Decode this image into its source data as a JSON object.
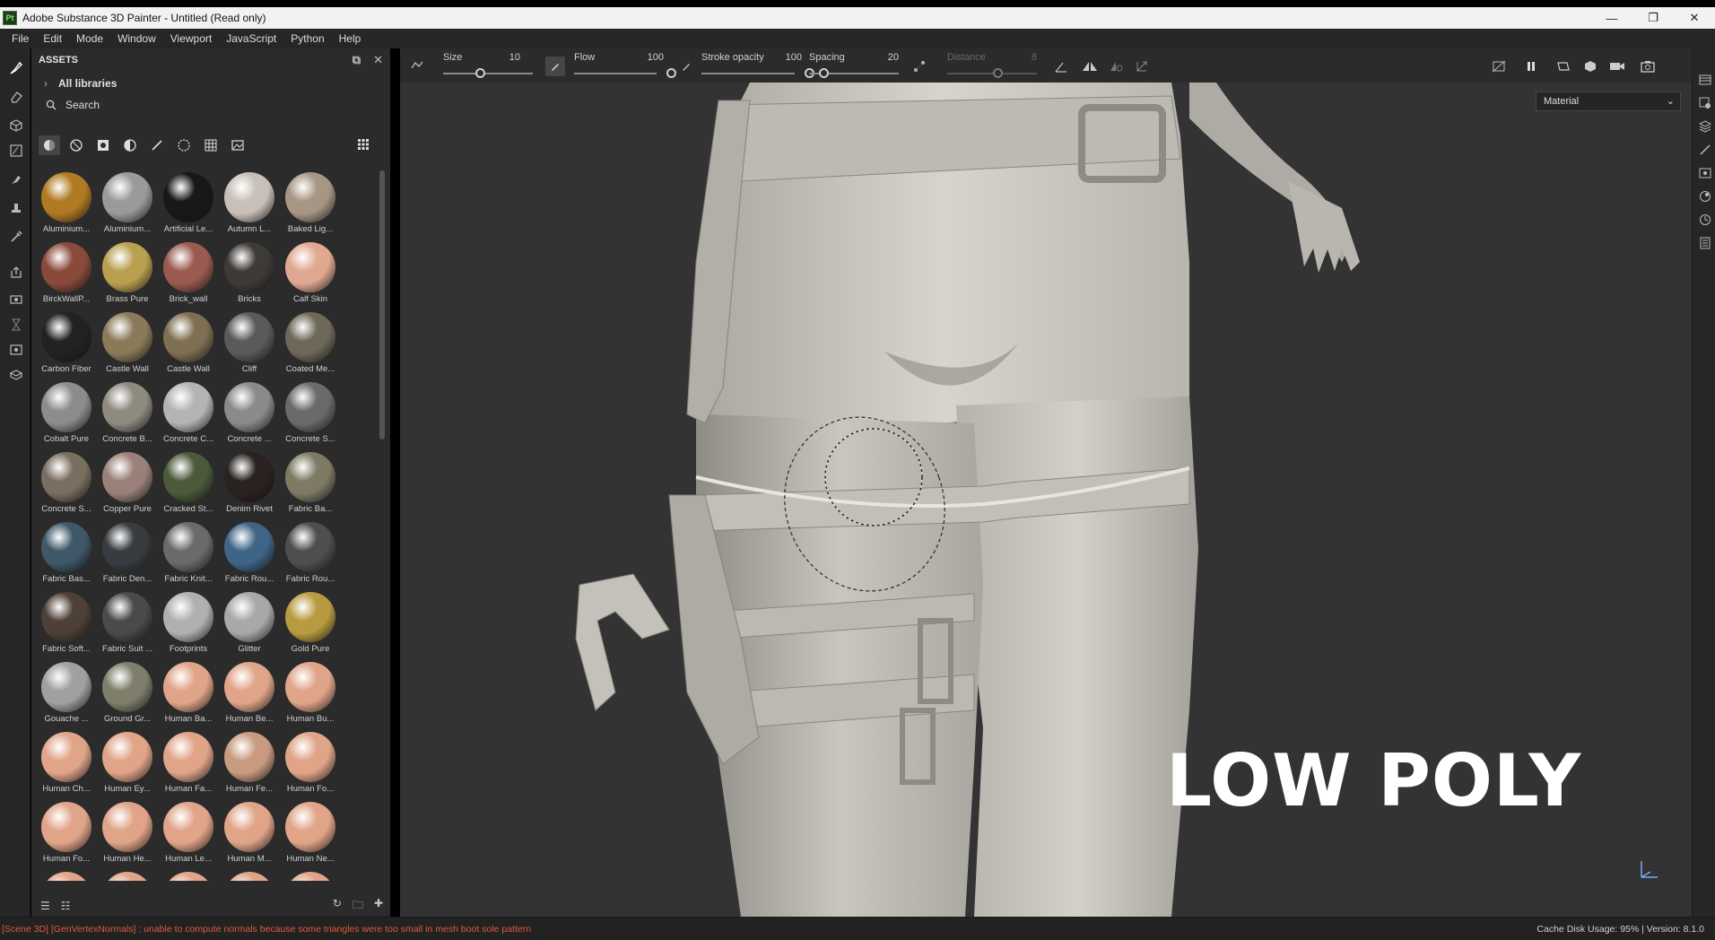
{
  "window": {
    "title": "Adobe Substance 3D Painter - Untitled (Read only)",
    "app_icon": "Pt",
    "controls": [
      "minimize-icon",
      "restore-icon",
      "close-icon"
    ]
  },
  "menu": [
    "File",
    "Edit",
    "Mode",
    "Window",
    "Viewport",
    "JavaScript",
    "Python",
    "Help"
  ],
  "assets_panel": {
    "title": "ASSETS",
    "libraries_label": "All libraries",
    "search_placeholder": "Search",
    "materials": [
      {
        "label": "Aluminium...",
        "color": "#b07a22"
      },
      {
        "label": "Aluminium...",
        "color": "#9a9a9a"
      },
      {
        "label": "Artificial Le...",
        "color": "#181818"
      },
      {
        "label": "Autumn L...",
        "color": "#c8c0b8"
      },
      {
        "label": "Baked Lig...",
        "color": "#a89684"
      },
      {
        "label": "BirckWallP...",
        "color": "#8a4a3a"
      },
      {
        "label": "Brass Pure",
        "color": "#b8a050"
      },
      {
        "label": "Brick_wall",
        "color": "#9a5a50"
      },
      {
        "label": "Bricks",
        "color": "#3e3a36"
      },
      {
        "label": "Calf Skin",
        "color": "#e0a890"
      },
      {
        "label": "Carbon Fiber",
        "color": "#222222"
      },
      {
        "label": "Castle Wall",
        "color": "#8a7a5a"
      },
      {
        "label": "Castle Wall",
        "color": "#7e6e52"
      },
      {
        "label": "Cliff",
        "color": "#5a5a58"
      },
      {
        "label": "Coated Me...",
        "color": "#6e6858"
      },
      {
        "label": "Cobalt Pure",
        "color": "#8c8c8c"
      },
      {
        "label": "Concrete B...",
        "color": "#8e8a80"
      },
      {
        "label": "Concrete C...",
        "color": "#b4b4b4"
      },
      {
        "label": "Concrete ...",
        "color": "#8a8a8a"
      },
      {
        "label": "Concrete S...",
        "color": "#6a6a6a"
      },
      {
        "label": "Concrete S...",
        "color": "#7a6e60"
      },
      {
        "label": "Copper Pure",
        "color": "#9a8078"
      },
      {
        "label": "Cracked St...",
        "color": "#4a5a3a"
      },
      {
        "label": "Denim Rivet",
        "color": "#2a2220"
      },
      {
        "label": "Fabric Ba...",
        "color": "#7e7a64"
      },
      {
        "label": "Fabric Bas...",
        "color": "#3e5868"
      },
      {
        "label": "Fabric Den...",
        "color": "#383c40"
      },
      {
        "label": "Fabric Knit...",
        "color": "#6a6a6a"
      },
      {
        "label": "Fabric Rou...",
        "color": "#3e6486"
      },
      {
        "label": "Fabric Rou...",
        "color": "#4e4e4e"
      },
      {
        "label": "Fabric Soft...",
        "color": "#4e4036"
      },
      {
        "label": "Fabric Suit ...",
        "color": "#4a4a4a"
      },
      {
        "label": "Footprints",
        "color": "#b0b0b0"
      },
      {
        "label": "Glitter",
        "color": "#a8a8a8"
      },
      {
        "label": "Gold Pure",
        "color": "#b89a40"
      },
      {
        "label": "Gouache ...",
        "color": "#a0a0a0"
      },
      {
        "label": "Ground Gr...",
        "color": "#7e7e6a"
      },
      {
        "label": "Human Ba...",
        "color": "#e0a488"
      },
      {
        "label": "Human Be...",
        "color": "#e0a488"
      },
      {
        "label": "Human Bu...",
        "color": "#e0a488"
      },
      {
        "label": "Human Ch...",
        "color": "#e0a488"
      },
      {
        "label": "Human Ey...",
        "color": "#e0a488"
      },
      {
        "label": "Human Fa...",
        "color": "#e0a488"
      },
      {
        "label": "Human Fe...",
        "color": "#c89a80"
      },
      {
        "label": "Human Fo...",
        "color": "#e0a488"
      },
      {
        "label": "Human Fo...",
        "color": "#e0a488"
      },
      {
        "label": "Human He...",
        "color": "#e0a488"
      },
      {
        "label": "Human Le...",
        "color": "#e0a488"
      },
      {
        "label": "Human M...",
        "color": "#e0a488"
      },
      {
        "label": "Human Ne...",
        "color": "#e0a488"
      },
      {
        "label": "",
        "color": "#e0a488"
      },
      {
        "label": "",
        "color": "#e0a488"
      },
      {
        "label": "",
        "color": "#e0a488"
      },
      {
        "label": "",
        "color": "#e0a488"
      },
      {
        "label": "",
        "color": "#e0a488"
      }
    ]
  },
  "toolbar": {
    "size_label": "Size",
    "size_value": "10",
    "size_level": 0.25,
    "flow_label": "Flow",
    "flow_value": "100",
    "flow_level": 1.0,
    "stroke_opacity_label": "Stroke opacity",
    "stroke_opacity_value": "100",
    "stroke_opacity_level": 1.0,
    "spacing_label": "Spacing",
    "spacing_value": "20",
    "spacing_level": 0.0,
    "distance_label": "Distance",
    "distance_value": "8",
    "distance_level": 0.4
  },
  "viewport": {
    "mode_dropdown": "Material",
    "overlay_text": "LOW POLY",
    "background": "#333333"
  },
  "status": {
    "error": "[Scene 3D] [GenVertexNormals] : unable to compute normals because some triangles were too small in mesh boot sole pattern",
    "cache": "Cache Disk Usage:    95% | Version: 8.1.0"
  }
}
